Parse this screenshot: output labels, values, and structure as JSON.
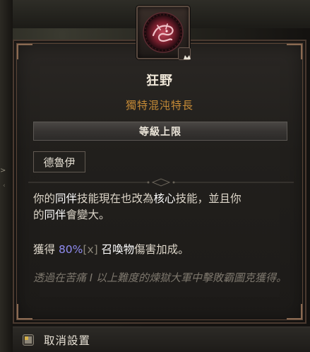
{
  "skill": {
    "name": "狂野",
    "type": "獨特混沌特長",
    "rank_label": "等級上限",
    "class_tag": "德魯伊",
    "icon": "beast-sigil-icon"
  },
  "description": {
    "line1_a": "你的",
    "line1_b": "同伴",
    "line1_c": "技能現在也改為",
    "line1_d": "核心",
    "line1_e": "技能，並且你",
    "line2_a": "的",
    "line2_b": "同伴",
    "line2_c": "會變大。"
  },
  "bonus": {
    "prefix": "獲得 ",
    "percent": "80%",
    "multiplier": "[x]",
    "keyword": "召喚物",
    "suffix": "傷害加成。"
  },
  "flavor_text": "透過在苦痛 I 以上難度的煉獄大軍中擊敗霸圖克獲得。",
  "action": {
    "label": "取消設置",
    "key_icon": "controller-button-icon"
  },
  "colors": {
    "title": "#efe7d8",
    "unique": "#c58a36",
    "value": "#8f8bf0",
    "flavor": "#7d776d"
  }
}
